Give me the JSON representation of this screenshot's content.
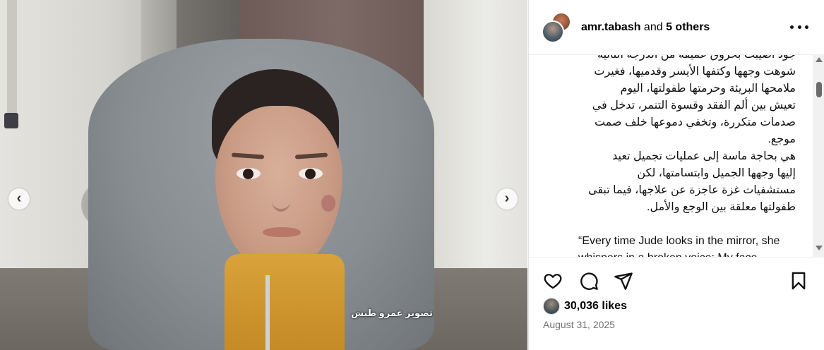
{
  "post": {
    "watermark": "تصوير عمرو طبش",
    "prev_glyph": "‹",
    "next_glyph": "›"
  },
  "header": {
    "username": "amr.tabash",
    "connector": " and ",
    "others": "5 others"
  },
  "caption": {
    "arabic_lines": [
      "جود أصيبت بحروق عميقة من الدرجة الثانية",
      "شوهت وجهها وكتفها الأيسر وقدميها، فغيرت",
      "ملامحها البريئة وحرمتها طفولتها، اليوم",
      "تعيش بين ألم الفقد وقسوة التنمر، تدخل في",
      "صدمات متكررة، وتخفي دموعها خلف صمت",
      "موجع.",
      "هي بحاجة ماسة إلى عمليات تجميل تعيد",
      "إليها وجهها الجميل وابتسامتها، لكن",
      "مستشفيات غزة عاجزة عن علاجها، فيما تبقى",
      "طفولتها معلقة بين الوجع والأمل."
    ],
    "english_lines": [
      "“Every time Jude looks in the mirror, she",
      "whispers in a broken voice: My face"
    ]
  },
  "actions": {
    "icons": [
      "heart-icon",
      "comment-icon",
      "share-icon",
      "bookmark-icon"
    ]
  },
  "likes": {
    "text": "30,036 likes"
  },
  "date": "August 31, 2025"
}
